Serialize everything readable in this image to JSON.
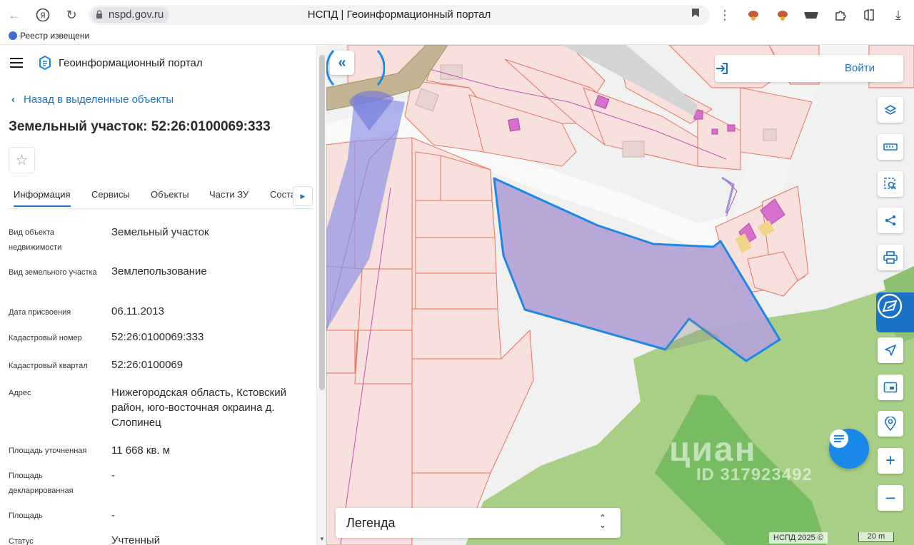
{
  "browser": {
    "url": "nspd.gov.ru",
    "tab_title": "НСПД | Геоинформационный портал",
    "bookmark": "Реестр извещени"
  },
  "panel": {
    "portal_title": "Геоинформационный портал",
    "back_link": "Назад в выделенные объекты",
    "object_title": "Земельный участок: 52:26:0100069:333",
    "tabs": [
      "Информация",
      "Сервисы",
      "Объекты",
      "Части ЗУ",
      "Соста"
    ],
    "rows": [
      {
        "label": "Вид объекта недвижимости",
        "value": "Земельный участок"
      },
      {
        "label": "Вид земельного участка",
        "value": "Землепользование"
      },
      {
        "label": "Дата присвоения",
        "value": "06.11.2013"
      },
      {
        "label": "Кадастровый номер",
        "value": "52:26:0100069:333"
      },
      {
        "label": "Кадастровый квартал",
        "value": "52:26:0100069"
      },
      {
        "label": "Адрес",
        "value": "Нижегородская область, Кстовский район, юго-восточная окраина д. Слопинец"
      },
      {
        "label": "Площадь уточненная",
        "value": "11 668 кв. м"
      },
      {
        "label": "Площадь декларированная",
        "value": "-"
      },
      {
        "label": "Площадь",
        "value": "-"
      },
      {
        "label": "Статус",
        "value": "Учтенный"
      }
    ]
  },
  "map": {
    "login_label": "Войти",
    "legend_label": "Легенда",
    "copyright": "НСПД 2025 ©",
    "scale": "20 m",
    "watermark_brand": "циан",
    "watermark_id": "ID 317923492",
    "colors": {
      "parcel_fill": "#f8e0dc",
      "parcel_stroke": "#e8735f",
      "selected_fill": "#b3a3d6",
      "selected_stroke": "#1e88e5",
      "forest": "#a9cf86",
      "accent": "#1a73c9"
    }
  }
}
